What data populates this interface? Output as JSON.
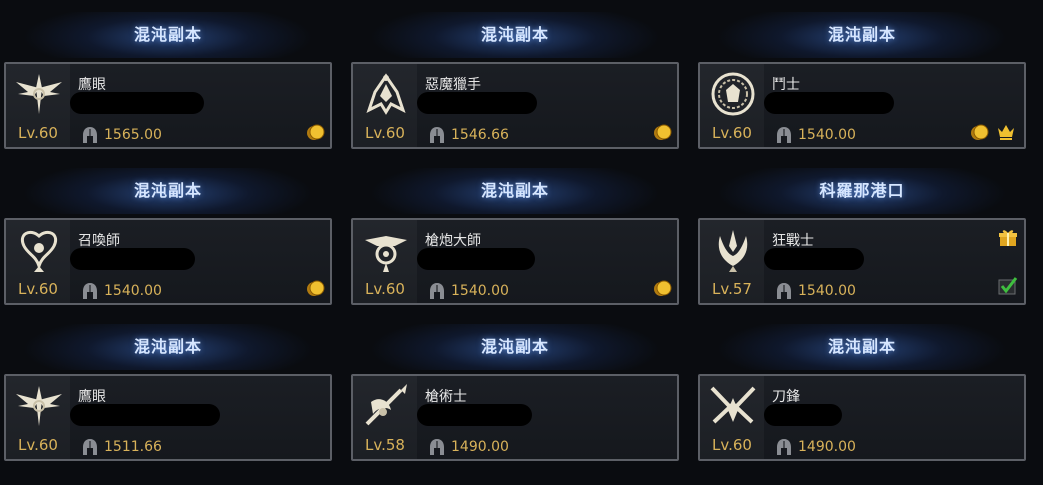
{
  "characters": [
    {
      "location": "混沌副本",
      "class": "鷹眼",
      "level": "Lv.60",
      "item_level": "1565.00",
      "icon": "sharpshooter-emblem-icon",
      "badges": [
        "coin"
      ]
    },
    {
      "location": "混沌副本",
      "class": "惡魔獵手",
      "level": "Lv.60",
      "item_level": "1546.66",
      "icon": "deadeye-emblem-icon",
      "badges": [
        "coin"
      ]
    },
    {
      "location": "混沌副本",
      "class": "鬥士",
      "level": "Lv.60",
      "item_level": "1540.00",
      "icon": "wardancer-emblem-icon",
      "badges": [
        "coin",
        "crown"
      ]
    },
    {
      "location": "混沌副本",
      "class": "召喚師",
      "level": "Lv.60",
      "item_level": "1540.00",
      "icon": "summoner-emblem-icon",
      "badges": [
        "coin"
      ]
    },
    {
      "location": "混沌副本",
      "class": "槍炮大師",
      "level": "Lv.60",
      "item_level": "1540.00",
      "icon": "gunlancer-emblem-icon",
      "badges": [
        "coin"
      ]
    },
    {
      "location": "科羅那港口",
      "class": "狂戰士",
      "level": "Lv.57",
      "item_level": "1540.00",
      "icon": "berserker-emblem-icon",
      "badges": [
        "gift",
        "check"
      ]
    },
    {
      "location": "混沌副本",
      "class": "鷹眼",
      "level": "Lv.60",
      "item_level": "1511.66",
      "icon": "sharpshooter-emblem-icon",
      "badges": []
    },
    {
      "location": "混沌副本",
      "class": "槍術士",
      "level": "Lv.58",
      "item_level": "1490.00",
      "icon": "lancemaster-emblem-icon",
      "badges": []
    },
    {
      "location": "混沌副本",
      "class": "刀鋒",
      "level": "Lv.60",
      "item_level": "1490.00",
      "icon": "deathblade-emblem-icon",
      "badges": []
    }
  ],
  "colors": {
    "level_gold": "#d8b25a",
    "location_blue": "#d6e6ff",
    "card_border": "#5c5f66"
  }
}
